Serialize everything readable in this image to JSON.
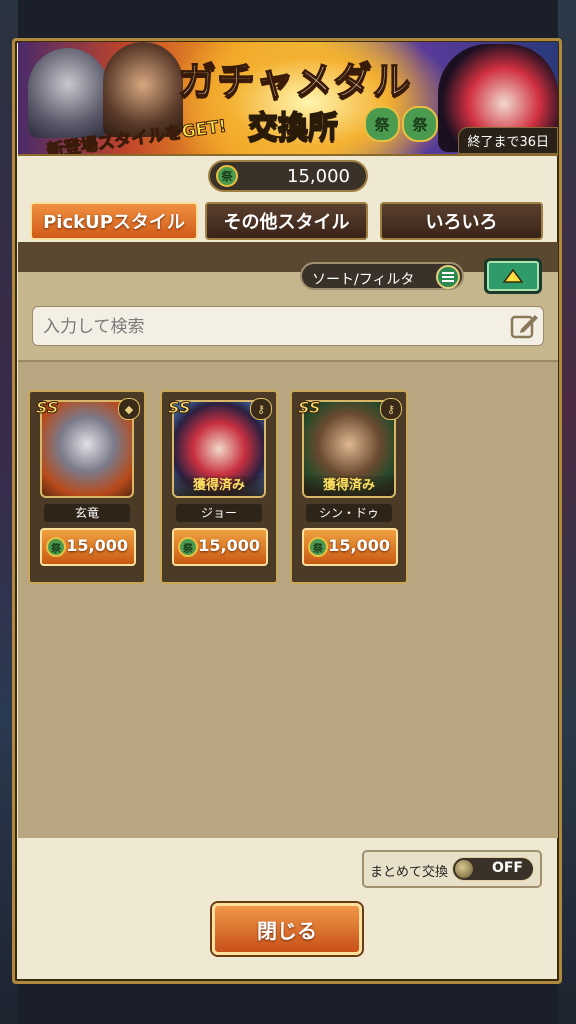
{
  "banner": {
    "title": "ガチャメダル",
    "subtitle": "交換所",
    "promo": "新登場スタイルをGET!",
    "time_remaining": "終了まで36日",
    "medal_glyph": "祭"
  },
  "currency": {
    "amount": "15,000",
    "icon": "medal-icon"
  },
  "tabs": [
    {
      "label": "PickUPスタイル",
      "active": true
    },
    {
      "label": "その他スタイル",
      "active": false
    },
    {
      "label": "いろいろ",
      "active": false
    }
  ],
  "filter": {
    "sort_label": "ソート/フィルタ"
  },
  "search": {
    "placeholder": "入力して検索"
  },
  "items": [
    {
      "name": "玄竜",
      "price": "15,000",
      "rank": "SS",
      "owned": ""
    },
    {
      "name": "ジョー",
      "price": "15,000",
      "rank": "SS",
      "owned": "獲得済み"
    },
    {
      "name": "シン・ドゥ",
      "price": "15,000",
      "rank": "SS",
      "owned": "獲得済み"
    }
  ],
  "bulk_exchange": {
    "label": "まとめて交換",
    "toggle": "OFF"
  },
  "close_button": {
    "label": "閉じる"
  },
  "colors": {
    "accent": "#e0782c",
    "panel": "#efe8d3",
    "toggle_green": "#2f9a6a"
  }
}
